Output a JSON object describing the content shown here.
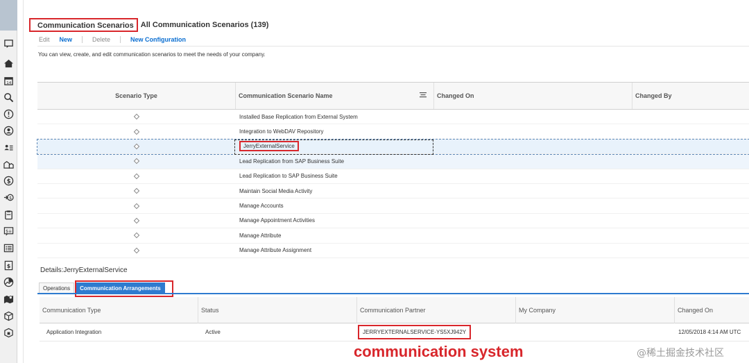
{
  "header": {
    "active_view": "Communication Scenarios",
    "view_title": "All Communication Scenarios (139)"
  },
  "toolbar": {
    "edit": "Edit",
    "new": "New",
    "delete": "Delete",
    "new_configuration": "New Configuration"
  },
  "description": "You can view, create, and edit communication scenarios to meet the needs of your company.",
  "grid": {
    "columns": {
      "scenario_type": "Scenario Type",
      "scenario_name": "Communication Scenario Name",
      "changed_on": "Changed On",
      "changed_by": "Changed By"
    },
    "rows": [
      {
        "name": "Installed Base Replication from External System"
      },
      {
        "name": "Integration to WebDAV Repository"
      },
      {
        "name": "JerryExternalService"
      },
      {
        "name": "Lead Replication from SAP Business Suite"
      },
      {
        "name": "Lead Replication to SAP Business Suite"
      },
      {
        "name": "Maintain Social Media Activity"
      },
      {
        "name": "Manage Accounts"
      },
      {
        "name": "Manage Appointment Activities"
      },
      {
        "name": "Manage Attribute"
      },
      {
        "name": "Manage Attribute Assignment"
      }
    ]
  },
  "details": {
    "title": "Details:JerryExternalService",
    "tabs": [
      "Operations",
      "Communication Arrangements"
    ],
    "arrangements": {
      "columns": [
        "Communication Type",
        "Status",
        "Communication Partner",
        "My Company",
        "Changed On"
      ],
      "rows": [
        {
          "type": "Application Integration",
          "status": "Active",
          "partner": "JERRYEXTERNALSERVICE-YS5XJ942Y",
          "company": "",
          "changed_on": "12/05/2018 4:14 AM UTC"
        }
      ]
    }
  },
  "annotation": "communication system",
  "watermark": "@稀土掘金技术社区",
  "sidebar_icons": [
    "feed-icon",
    "home-icon",
    "calendar-icon",
    "search-icon",
    "alert-icon",
    "person-icon",
    "contacts-icon",
    "accounts-icon",
    "money-icon",
    "pipeline-icon",
    "clipboard-icon",
    "quote-icon",
    "list-icon",
    "invoice-icon",
    "analytics-icon",
    "map-icon",
    "box-icon",
    "package-icon"
  ],
  "colors": {
    "highlight_red": "#d8262b",
    "link_blue": "#0a6ed1",
    "tab_blue": "#2e7bcf",
    "selection_bg": "#e8f2fb"
  }
}
